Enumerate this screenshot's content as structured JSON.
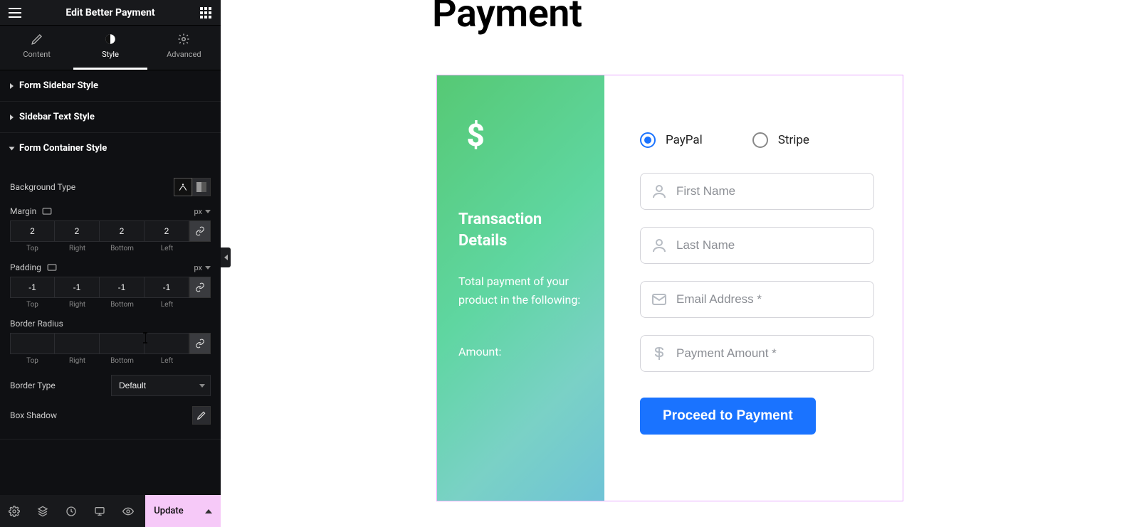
{
  "header": {
    "title": "Edit Better Payment"
  },
  "tabs": [
    {
      "label": "Content",
      "active": false
    },
    {
      "label": "Style",
      "active": true
    },
    {
      "label": "Advanced",
      "active": false
    }
  ],
  "sections": {
    "sidebar_style": {
      "title": "Form Sidebar Style"
    },
    "text_style": {
      "title": "Sidebar Text Style"
    },
    "container_style": {
      "title": "Form Container Style"
    }
  },
  "controls": {
    "background_type_label": "Background Type",
    "margin": {
      "label": "Margin",
      "unit": "px",
      "top": "2",
      "right": "2",
      "bottom": "2",
      "left": "2"
    },
    "padding": {
      "label": "Padding",
      "unit": "px",
      "top": "-1",
      "right": "-1",
      "bottom": "-1",
      "left": "-1"
    },
    "border_radius": {
      "label": "Border Radius",
      "top": "",
      "right": "",
      "bottom": "",
      "left": ""
    },
    "dir_labels": {
      "top": "Top",
      "right": "Right",
      "bottom": "Bottom",
      "left": "Left"
    },
    "border_type": {
      "label": "Border Type",
      "value": "Default"
    },
    "box_shadow": {
      "label": "Box Shadow"
    }
  },
  "footer": {
    "update_label": "Update"
  },
  "canvas": {
    "page_title": "Payment",
    "sidebar": {
      "title": "Transaction Details",
      "desc": "Total payment of your product in the following:",
      "amount_label": "Amount:"
    },
    "form": {
      "radios": [
        {
          "label": "PayPal",
          "selected": true
        },
        {
          "label": "Stripe",
          "selected": false
        }
      ],
      "first_name_ph": "First Name",
      "last_name_ph": "Last Name",
      "email_ph": "Email Address *",
      "amount_ph": "Payment Amount *",
      "submit_label": "Proceed to Payment"
    }
  }
}
